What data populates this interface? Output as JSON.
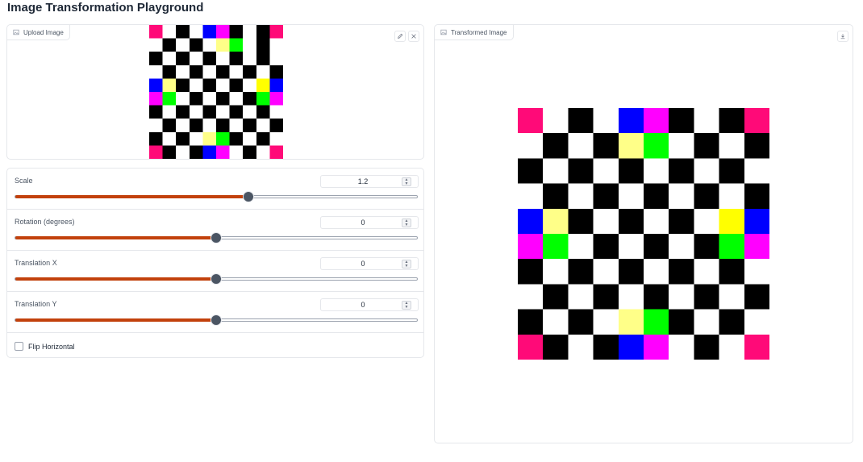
{
  "app": {
    "title": "Image Transformation Playground"
  },
  "upload": {
    "label": "Upload Image"
  },
  "output": {
    "label": "Transformed Image"
  },
  "controls": {
    "sliders": [
      {
        "label": "Scale",
        "value": "1.2",
        "fraction": 0.58
      },
      {
        "label": "Rotation (degrees)",
        "value": "0",
        "fraction": 0.5
      },
      {
        "label": "Translation X",
        "value": "0",
        "fraction": 0.5
      },
      {
        "label": "Translation Y",
        "value": "0",
        "fraction": 0.5
      }
    ],
    "flip": {
      "label": "Flip Horizontal",
      "checked": false
    }
  },
  "colors": {
    "accent": "#c2410c",
    "K": "#000000",
    "W": "#ffffff",
    "P": "#ff0a78",
    "B": "#0000ff",
    "M": "#ff00ff",
    "Y": "#ffff00",
    "L": "#ffff88",
    "G": "#00ff00"
  },
  "input_image": {
    "grid": [
      "PWKWBMKWKP",
      "WKWKWLGWKW",
      "KWKWKWKWKW",
      "WKWKWKWKWK",
      "BLKWKWKWYB",
      "MGWKWKWKGM",
      "KWKWKWKWKW",
      "WKWKWKWKWK",
      "KWKWLGKWKW",
      "PKWKBMWKWP"
    ]
  },
  "output_image": {
    "grid": [
      "PWKWBMKWKP",
      "WKWKLGWKWK",
      "KWKWKWKWKW",
      "WKWKWKWKWK",
      "BLKWKWKWYB",
      "MGWKWKWKGM",
      "KWKWKWKWKW",
      "WKWKWKWKWK",
      "KWKWLGKWKW",
      "PKWKBMWKWP"
    ]
  }
}
